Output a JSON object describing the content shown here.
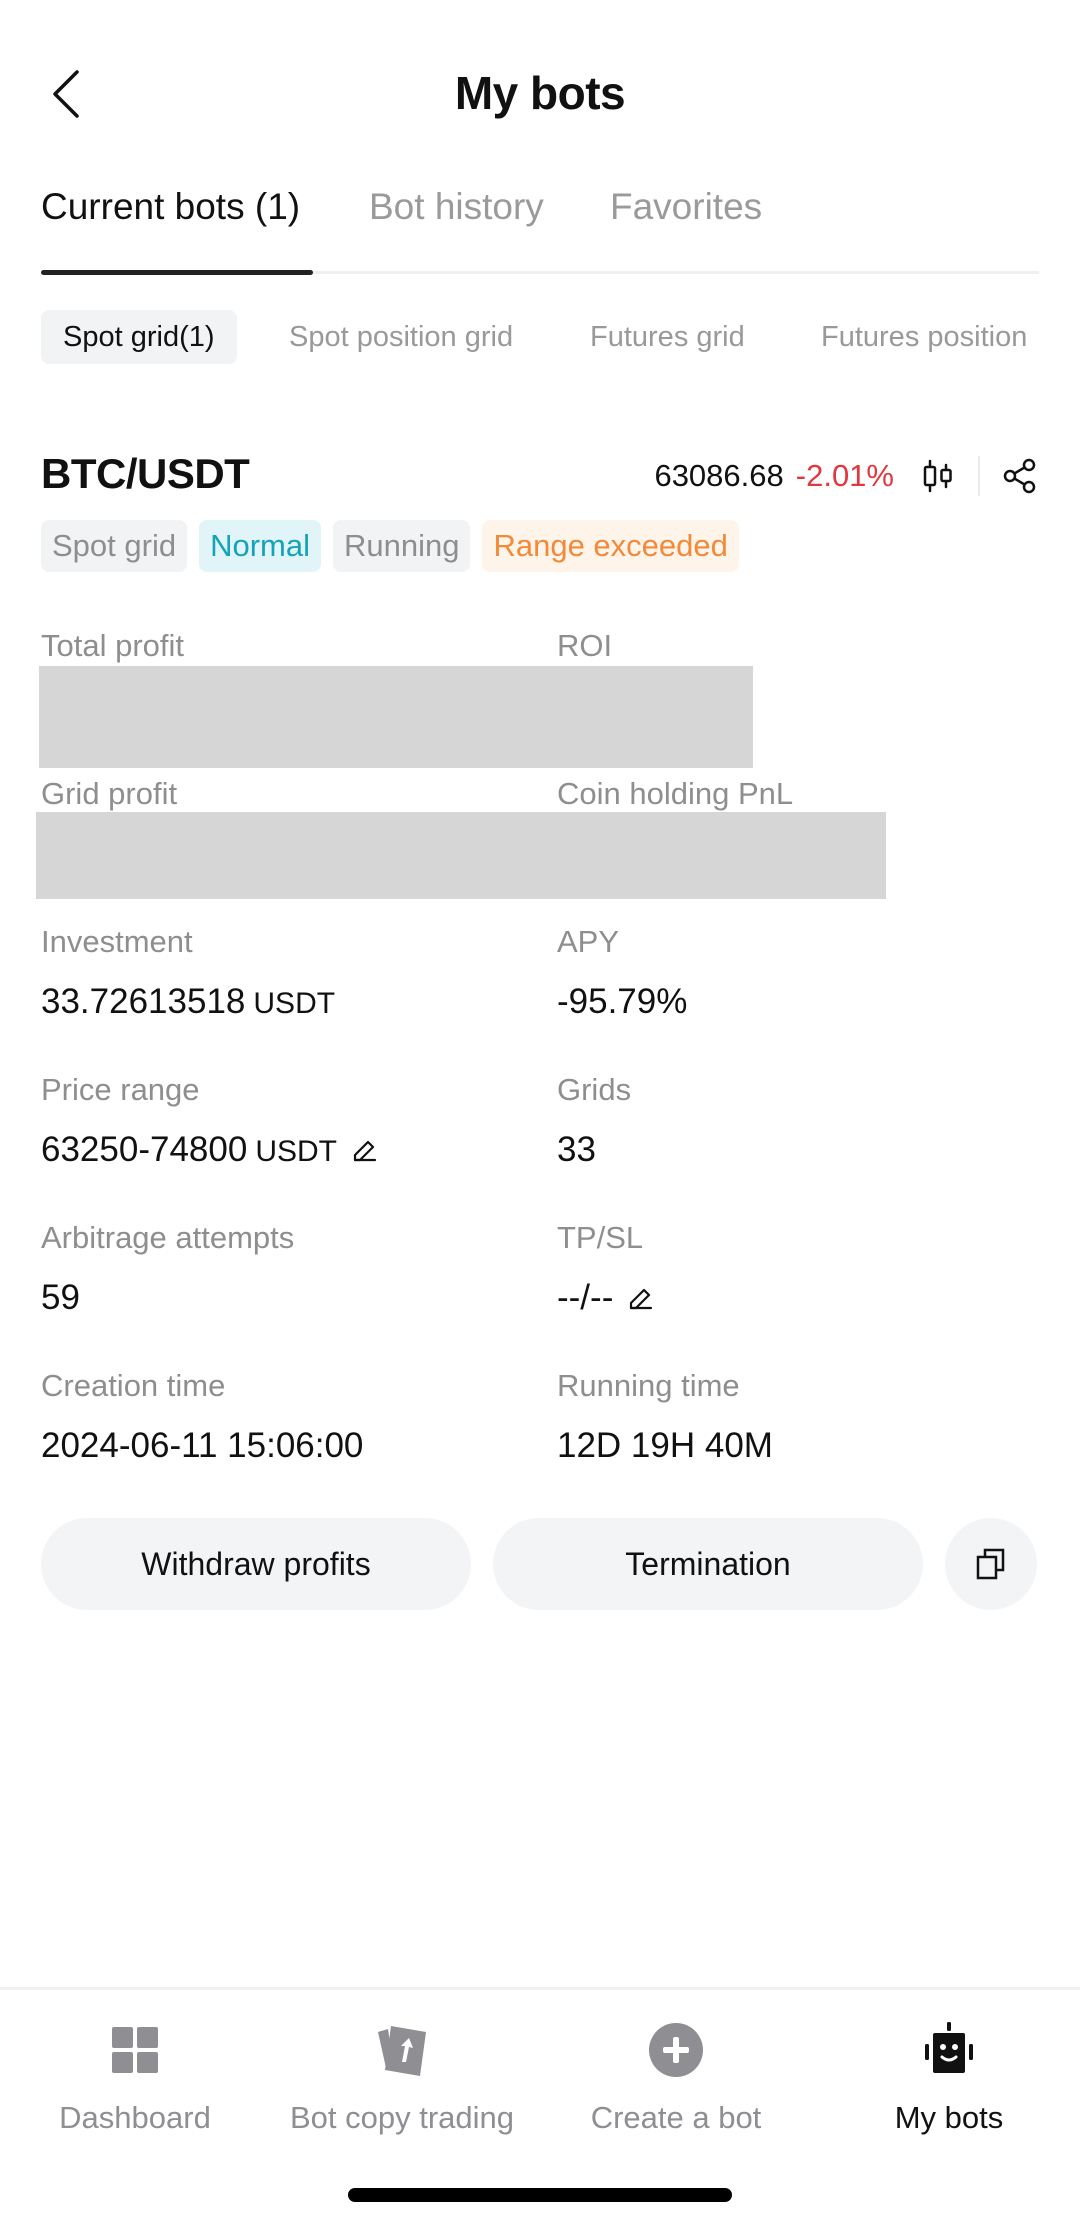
{
  "header": {
    "title": "My bots",
    "back_icon": "chevron-left-icon"
  },
  "main_tabs": [
    {
      "label": "Current bots (1)",
      "active": true
    },
    {
      "label": "Bot history",
      "active": false
    },
    {
      "label": "Favorites",
      "active": false
    }
  ],
  "sub_tabs": [
    {
      "label": "Spot grid(1)",
      "active": true
    },
    {
      "label": "Spot position grid",
      "active": false
    },
    {
      "label": "Futures grid",
      "active": false
    },
    {
      "label": "Futures position",
      "active": false
    }
  ],
  "bot": {
    "pair": "BTC/USDT",
    "price": "63086.68",
    "change": "-2.01%",
    "change_color": "#e0383e",
    "chart_icon": "candlestick-icon",
    "share_icon": "share-icon",
    "tags": [
      {
        "label": "Spot grid",
        "style": "gray"
      },
      {
        "label": "Normal",
        "style": "cyan"
      },
      {
        "label": "Running",
        "style": "gray"
      },
      {
        "label": "Range exceeded",
        "style": "orange"
      }
    ],
    "stats": {
      "total_profit": {
        "label": "Total profit"
      },
      "roi": {
        "label": "ROI"
      },
      "grid_profit": {
        "label": "Grid profit"
      },
      "coin_holding_pnl": {
        "label": "Coin holding PnL"
      },
      "investment": {
        "label": "Investment",
        "value": "33.72613518",
        "unit": "USDT"
      },
      "apy": {
        "label": "APY",
        "value": "-95.79%"
      },
      "price_range": {
        "label": "Price range",
        "value": "63250-74800",
        "unit": "USDT"
      },
      "grids": {
        "label": "Grids",
        "value": "33"
      },
      "arbitrage_attempts": {
        "label": "Arbitrage attempts",
        "value": "59"
      },
      "tpsl": {
        "label": "TP/SL",
        "value": "--/--"
      },
      "creation_time": {
        "label": "Creation time",
        "value": "2024-06-11 15:06:00"
      },
      "running_time": {
        "label": "Running time",
        "value": "12D 19H 40M"
      }
    },
    "actions": {
      "withdraw": "Withdraw profits",
      "terminate": "Termination",
      "copy_icon": "copy-icon"
    }
  },
  "bottom_nav": [
    {
      "label": "Dashboard",
      "icon": "dashboard-grid-icon",
      "active": false
    },
    {
      "label": "Bot copy trading",
      "icon": "copy-trading-cards-icon",
      "active": false
    },
    {
      "label": "Create a bot",
      "icon": "plus-circle-icon",
      "active": false
    },
    {
      "label": "My bots",
      "icon": "robot-icon",
      "active": true
    }
  ],
  "colors": {
    "accent_text": "#111111",
    "muted_text": "#8e8e8e",
    "negative": "#e0383e",
    "tag_cyan": "#14a3b8",
    "tag_orange": "#f28a3a"
  }
}
